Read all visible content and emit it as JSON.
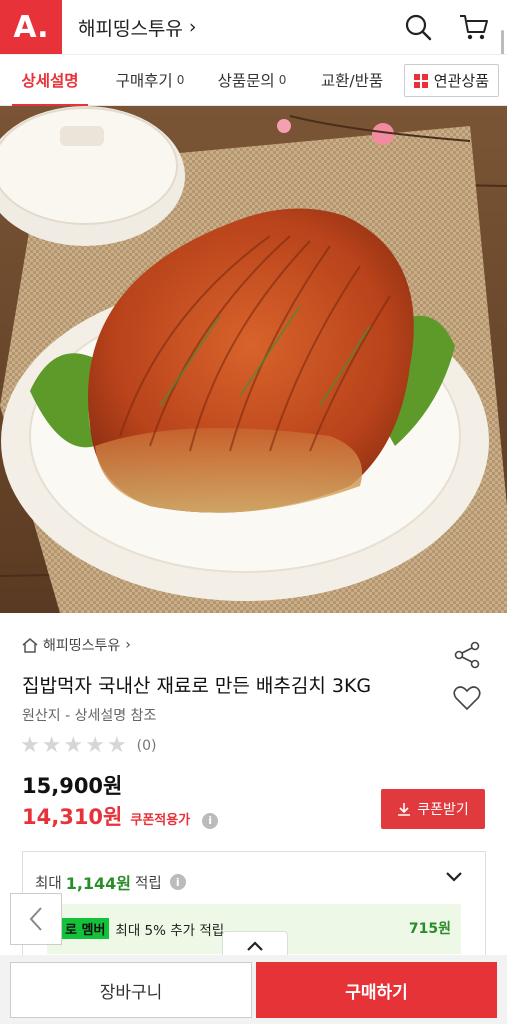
{
  "header": {
    "logo": "A.",
    "store_name": "해피띵스투유",
    "store_chevron": "›",
    "icons": [
      "search-icon",
      "cart-icon"
    ]
  },
  "tabs": [
    {
      "label": "상세설명",
      "count": "",
      "active": true
    },
    {
      "label": "구매후기",
      "count": "0",
      "active": false
    },
    {
      "label": "상품문의",
      "count": "0",
      "active": false
    },
    {
      "label": "교환/반품",
      "count": "",
      "active": false
    }
  ],
  "related_tab": {
    "label": "연관상품"
  },
  "product": {
    "store_crumb": "해피띵스투유",
    "title": "집밥먹자 국내산 재료로 만든 배추김치 3KG",
    "origin": "원산지 - 상세설명 참조",
    "rating_count": "(0)",
    "stars": 0,
    "price_original": "15,900원",
    "price_sale": "14,310원",
    "coupon_note": "쿠폰적용가",
    "coupon_button": "쿠폰받기"
  },
  "points": {
    "prefix": "최대",
    "amount": "1,144원",
    "suffix": "적립",
    "member_badge": "멤버",
    "member_badge_prefix": "로",
    "member_text": "최대 5% 추가 적립",
    "member_amount": "715원"
  },
  "bottom": {
    "cart_label": "장바구니",
    "buy_label": "구매하기"
  },
  "colors": {
    "brand": "#e8323a",
    "points_green": "#2a8d2a"
  }
}
